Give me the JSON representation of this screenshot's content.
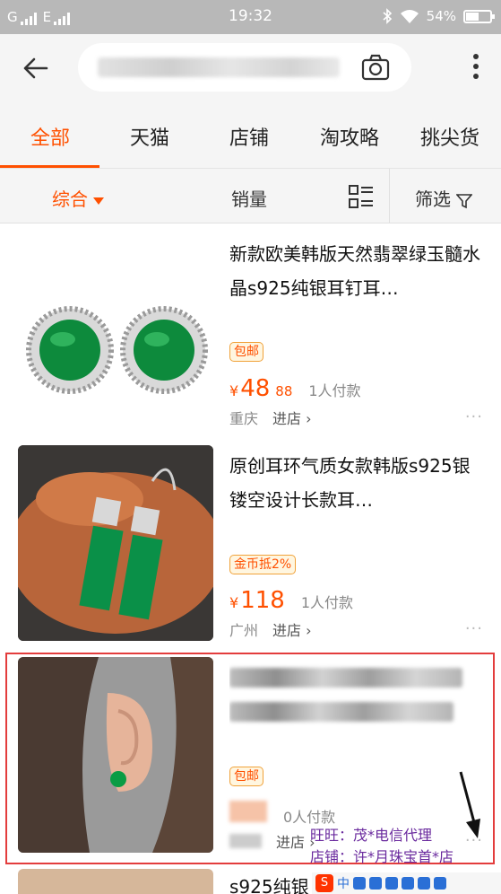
{
  "status_bar": {
    "network_left": "G",
    "network_right": "E",
    "time": "19:32",
    "battery": "54%"
  },
  "search": {
    "back_icon": "arrow-left-icon",
    "camera_icon": "camera-icon",
    "more_icon": "more-vertical-icon"
  },
  "tabs": [
    {
      "label": "全部",
      "active": true
    },
    {
      "label": "天猫",
      "active": false
    },
    {
      "label": "店铺",
      "active": false
    },
    {
      "label": "淘攻略",
      "active": false
    },
    {
      "label": "挑尖货",
      "active": false
    }
  ],
  "sort": {
    "comprehensive": "综合",
    "sales": "销量",
    "filter": "筛选"
  },
  "items": [
    {
      "title": "新款欧美韩版天然翡翠绿玉髓水晶s925纯银耳钉耳…",
      "badge": "包邮",
      "currency": "¥",
      "price": "48",
      "price_tag": "88",
      "sales": "1人付款",
      "location": "重庆",
      "shop_link": "进店 ›",
      "more": "···"
    },
    {
      "title": "原创耳环气质女款韩版s925银镂空设计长款耳…",
      "badge": "金币抵2%",
      "currency": "¥",
      "price": "118",
      "sales": "1人付款",
      "location": "广州",
      "shop_link": "进店 ›",
      "more": "···"
    },
    {
      "badge": "包邮",
      "sales": "0人付款",
      "shop_link": "进店 ›",
      "more": "···"
    }
  ],
  "annotation": {
    "wangwang": "旺旺：茂*电信代理",
    "shop": "店铺：许*月珠宝首*店"
  },
  "item4": {
    "title_fragment": "s925纯银"
  },
  "keyboard": {
    "logo": "S",
    "lang": "中"
  },
  "colors": {
    "accent": "#ff5000",
    "highlight": "#e33d3d",
    "annotation": "#6a2a9e"
  }
}
